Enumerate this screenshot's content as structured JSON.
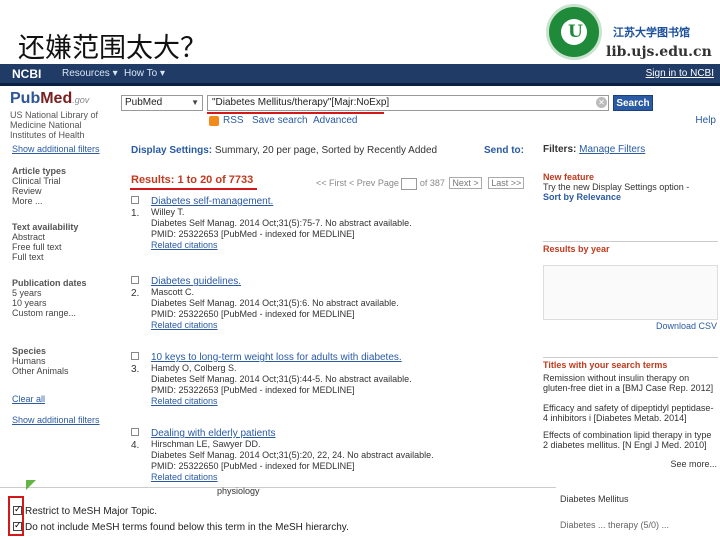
{
  "slide": {
    "title": "还嫌范围太大？",
    "library_name": "江苏大学图书馆",
    "library_url": "lib.ujs.edu.cn",
    "logo_text": "U"
  },
  "ncbi": {
    "logo": "NCBI",
    "resources": "Resources ▾",
    "howto": "How To ▾",
    "signin": "Sign in to NCBI"
  },
  "pubmed": {
    "logo_pub": "Pub",
    "logo_med": "Med",
    "logo_gov": ".gov",
    "institution": "US National Library of Medicine National Institutes of Health"
  },
  "search": {
    "database": "PubMed",
    "query": "\"Diabetes Mellitus/therapy\"[Majr:NoExp]",
    "button": "Search",
    "rss": "RSS",
    "save_search": "Save search",
    "advanced": "Advanced",
    "help": "Help"
  },
  "sidebar": {
    "show_filters": "Show additional filters",
    "article_types_head": "Article types",
    "article_types": [
      "Clinical Trial",
      "Review",
      "More ..."
    ],
    "text_avail_head": "Text availability",
    "text_avail": [
      "Abstract",
      "Free full text",
      "Full text"
    ],
    "pub_dates_head": "Publication dates",
    "pub_dates": [
      "5 years",
      "10 years",
      "Custom range..."
    ],
    "species_head": "Species",
    "species": [
      "Humans",
      "Other Animals"
    ],
    "clear_all": "Clear all",
    "show_filters2": "Show additional filters"
  },
  "display": {
    "label": "Display Settings:",
    "value": "Summary, 20 per page, Sorted by Recently Added",
    "send_to": "Send to:",
    "results": "Results: 1 to 20 of 7733",
    "first": "<< First",
    "prev": "< Prev",
    "page_label": "Page",
    "page_of": "of 387",
    "next": "Next >",
    "last": "Last >>"
  },
  "results": [
    {
      "num": "1.",
      "title": "Diabetes self-management.",
      "authors": "Willey T.",
      "cite": "Diabetes Self Manag. 2014 Oct;31(5):75-7. No abstract available.",
      "pmid": "PMID: 25322653 [PubMed - indexed for MEDLINE]",
      "related": "Related citations"
    },
    {
      "num": "2.",
      "title": "Diabetes guidelines.",
      "authors": "Mascott C.",
      "cite": "Diabetes Self Manag. 2014 Oct;31(5):6. No abstract available.",
      "pmid": "PMID: 25322650 [PubMed - indexed for MEDLINE]",
      "related": "Related citations"
    },
    {
      "num": "3.",
      "title": "10 keys to long-term weight loss for adults with diabetes.",
      "authors": "Hamdy O, Colberg S.",
      "cite": "Diabetes Self Manag. 2014 Oct;31(5):44-5. No abstract available.",
      "pmid": "PMID: 25322653 [PubMed - indexed for MEDLINE]",
      "related": "Related citations"
    },
    {
      "num": "4.",
      "title": "Dealing with elderly patients",
      "authors": "Hirschman LE, Sawyer DD.",
      "cite": "Diabetes Self Manag. 2014 Oct;31(5):20, 22, 24. No abstract available.",
      "pmid": "PMID: 25322650 [PubMed - indexed for MEDLINE]",
      "related": "Related citations"
    }
  ],
  "right": {
    "filters_label": "Filters:",
    "manage_filters": "Manage Filters",
    "new_feature": "New feature",
    "new_feature_text": "Try the new Display Settings option -",
    "sort_relevance": "Sort by Relevance",
    "results_by_year": "Results by year",
    "download_csv": "Download CSV",
    "titles_head": "Titles with your search terms",
    "titles": [
      "Remission without insulin therapy on gluten-free diet in a [BMJ Case Rep. 2012]",
      "Efficacy and safety of dipeptidyl peptidase-4 inhibitors i [Diabetes Metab. 2014]",
      "Effects of combination lipid therapy in type 2 diabetes mellitus. [N Engl J Med. 2010]"
    ],
    "see_more": "See more..."
  },
  "popup": {
    "physiology": "physiology",
    "restrict": "Restrict to MeSH Major Topic.",
    "do_not_include": "Do not include MeSH terms found below this term in the MeSH hierarchy.",
    "diabetes": "Diabetes Mellitus",
    "mesh_more": "Diabetes ... therapy (5/0) ..."
  }
}
